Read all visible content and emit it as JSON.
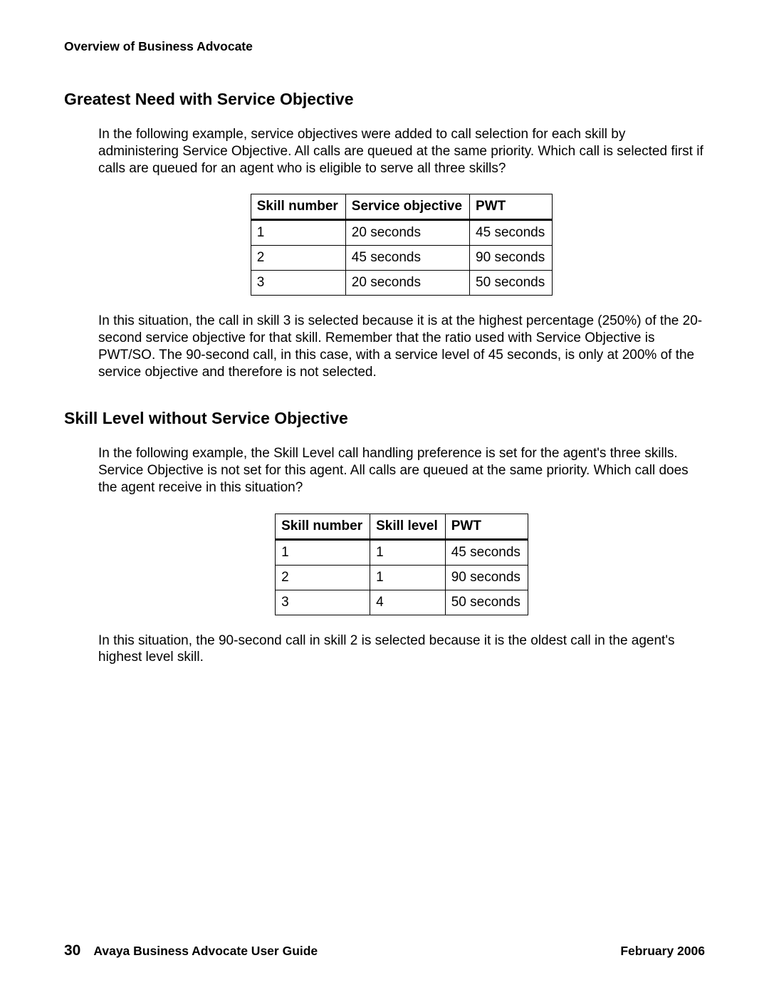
{
  "running_head": "Overview of Business Advocate",
  "section1": {
    "title": "Greatest Need with Service Objective",
    "intro": "In the following example, service objectives were added to call selection for each skill by administering Service Objective. All calls are queued at the same priority. Which call is selected first if calls are queued for an agent who is eligible to serve all three skills?",
    "conclusion": "In this situation, the call in skill 3 is selected because it is at the highest percentage (250%) of the 20-second service objective for that skill. Remember that the ratio used with Service Objective is PWT/SO. The 90-second call, in this case, with a service level of 45 seconds, is only at 200% of the service objective and therefore is not selected."
  },
  "table1": {
    "headers": [
      "Skill number",
      "Service objective",
      "PWT"
    ],
    "rows": [
      [
        "1",
        "20 seconds",
        "45 seconds"
      ],
      [
        "2",
        "45 seconds",
        "90 seconds"
      ],
      [
        "3",
        "20 seconds",
        "50 seconds"
      ]
    ]
  },
  "section2": {
    "title": "Skill Level without Service Objective",
    "intro": "In the following example, the Skill Level call handling preference is set for the agent's three skills. Service Objective is not set for this agent. All calls are queued at the same priority. Which call does the agent receive in this situation?",
    "conclusion": "In this situation, the 90-second call in skill 2 is selected because it is the oldest call in the agent's highest level skill."
  },
  "table2": {
    "headers": [
      "Skill number",
      "Skill level",
      "PWT"
    ],
    "rows": [
      [
        "1",
        "1",
        "45 seconds"
      ],
      [
        "2",
        "1",
        "90 seconds"
      ],
      [
        "3",
        "4",
        "50 seconds"
      ]
    ]
  },
  "footer": {
    "page_number": "30",
    "doc_title": "Avaya Business Advocate User Guide",
    "date": "February 2006"
  }
}
